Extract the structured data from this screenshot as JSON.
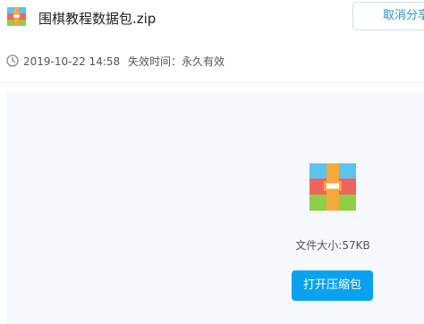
{
  "file": {
    "name": "围棋教程数据包.zip",
    "icon": "zip-archive-icon"
  },
  "header": {
    "cancel_share_label": "取消分享"
  },
  "meta": {
    "clock_icon": "clock-icon",
    "share_date": "2019-10-22 14:58",
    "expire_label": "失效时间：永久有效"
  },
  "preview": {
    "file_size": "文件大小:57KB",
    "open_button_label": "打开压缩包"
  },
  "colors": {
    "accent": "#08a2ef",
    "link": "#2a90db",
    "panel_bg": "#f5f8fc"
  }
}
